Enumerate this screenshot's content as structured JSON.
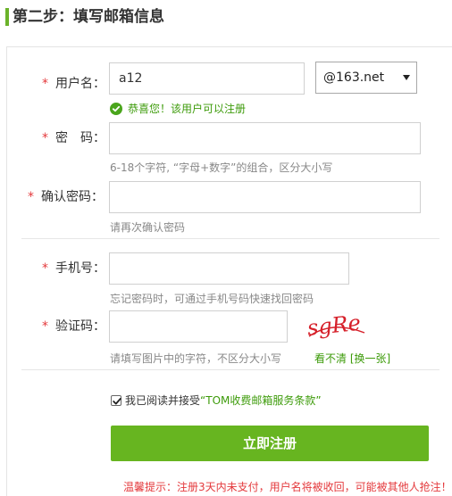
{
  "step": {
    "title": "第二步：填写邮箱信息"
  },
  "form": {
    "required_mark": "*",
    "username": {
      "label": "用户名：",
      "value": "a12",
      "domain_selected": "@163.net",
      "success_msg": "恭喜您！该用户可以注册"
    },
    "password": {
      "label": "密　码：",
      "value": "",
      "hint": "6-18个字符, “字母+数字”的组合，区分大小写"
    },
    "confirm_password": {
      "label": "确认密码：",
      "value": "",
      "hint": "请再次确认密码"
    },
    "phone": {
      "label": "手机号：",
      "value": "",
      "hint": "忘记密码时，可通过手机号码快速找回密码"
    },
    "captcha": {
      "label": "验证码：",
      "value": "",
      "image_text": "sgRe",
      "hint": "请填写图片中的字符，不区分大小写",
      "refresh_label": "看不清 [换一张]"
    },
    "agreement": {
      "checked": true,
      "text": "我已阅读并接受",
      "link_text": "“TOM收费邮箱服务条款”"
    },
    "submit_label": "立即注册",
    "notice": "温馨提示：注册3天内未支付，用户名将被收回，可能被其他人抢注！"
  },
  "colors": {
    "accent": "#67b520",
    "success": "#3d9b0a",
    "required": "#e4393c",
    "captcha": "#d6202a"
  }
}
